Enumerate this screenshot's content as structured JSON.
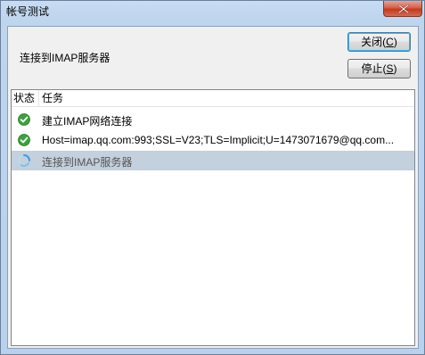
{
  "window": {
    "title": "帐号测试"
  },
  "dialog": {
    "status_message": "连接到IMAP服务器",
    "close_button": {
      "label": "关闭",
      "mnemonic": "C"
    },
    "stop_button": {
      "label": "停止",
      "mnemonic": "S"
    }
  },
  "list": {
    "columns": [
      "状态",
      "任务"
    ],
    "rows": [
      {
        "status": "success",
        "icon": "check-circle-icon",
        "task": "建立IMAP网络连接"
      },
      {
        "status": "success",
        "icon": "check-circle-icon",
        "task": "Host=imap.qq.com:993;SSL=V23;TLS=Implicit;U=1473071679@qq.com..."
      },
      {
        "status": "in-progress",
        "icon": "spinner-icon",
        "task": "连接到IMAP服务器"
      }
    ]
  },
  "colors": {
    "success": "#3aa23a",
    "spinner": "#3c9ee0",
    "selected_row": "#c3d0dd"
  }
}
